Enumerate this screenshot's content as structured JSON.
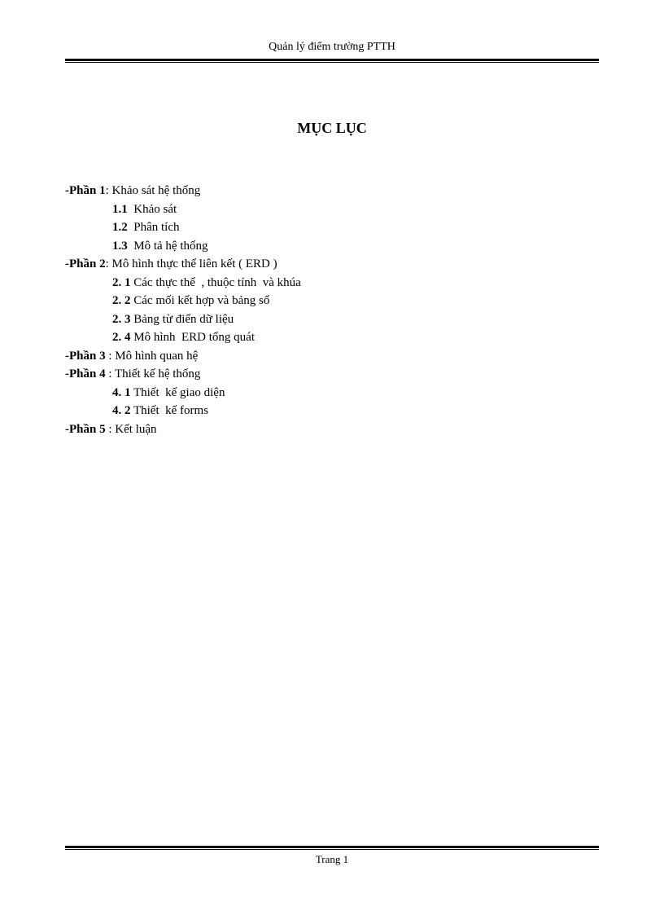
{
  "header": "Quản lý điểm trường PTTH",
  "title": "MỤC LỤC",
  "parts": [
    {
      "label": "-Phần 1",
      "sep": ": ",
      "text": "Khảo sát hệ thống",
      "subs": [
        {
          "num": "1.1",
          "text": "  Khảo sát"
        },
        {
          "num": "1.2",
          "text": "  Phân tích"
        },
        {
          "num": "1.3",
          "text": "  Mô tả hệ thống"
        }
      ]
    },
    {
      "label": "-Phần 2",
      "sep": ": ",
      "text": "Mô hình  thực thể liên  kết ( ERD )",
      "subs": [
        {
          "num": "2. 1",
          "text": " Các thực thể  , thuộc tính  và khúa"
        },
        {
          "num": "2. 2",
          "text": " Các mối kết hợp và bảng số"
        },
        {
          "num": "2. 3",
          "text": " Bảng từ điển dữ liệu"
        },
        {
          "num": "2. 4",
          "text": " Mô hình  ERD tổng quát"
        }
      ]
    },
    {
      "label": "-Phần 3",
      "sep": " : ",
      "text": "Mô hình  quan hệ",
      "subs": []
    },
    {
      "label": "-Phần 4",
      "sep": " : ",
      "text": "Thiết  kế hệ thống",
      "subs": [
        {
          "num": "4. 1",
          "text": " Thiết  kế giao diện"
        },
        {
          "num": "4. 2",
          "text": " Thiết  kế forms"
        }
      ]
    },
    {
      "label": "-Phần 5",
      "sep": " : ",
      "text": "Kết luận",
      "subs": []
    }
  ],
  "footer": "Trang 1"
}
